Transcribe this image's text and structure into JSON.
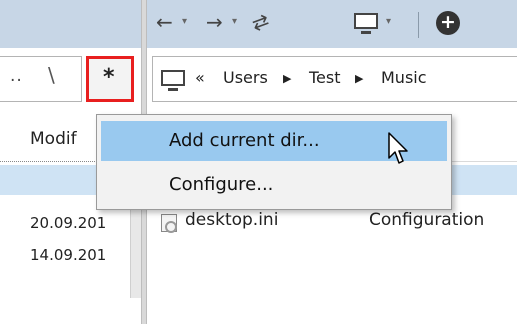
{
  "left_panel": {
    "path_dots": "..",
    "path_sep": "\\",
    "favorites_button": "*",
    "column_modified": "Modif",
    "dates": [
      "20.09.201",
      "14.09.201"
    ]
  },
  "toolbar": {
    "back": "←",
    "forward": "→",
    "sync": "⇄",
    "add": "+",
    "caret": "▾"
  },
  "address_bar": {
    "overflow": "«",
    "crumbs": [
      "Users",
      "Test",
      "Music"
    ],
    "crumb_separator": "▶"
  },
  "file_list": {
    "rows": [
      {
        "name": "desktop.ini",
        "type": "Configuration"
      }
    ]
  },
  "context_menu": {
    "items": [
      {
        "label": "Add current dir..."
      },
      {
        "label": "Configure..."
      }
    ]
  },
  "colors": {
    "toolbar_bg": "#c7d6e6",
    "selection": "#cfe3f4",
    "menu_highlight": "#99c9ef",
    "focus_outline": "#e81f1f"
  }
}
